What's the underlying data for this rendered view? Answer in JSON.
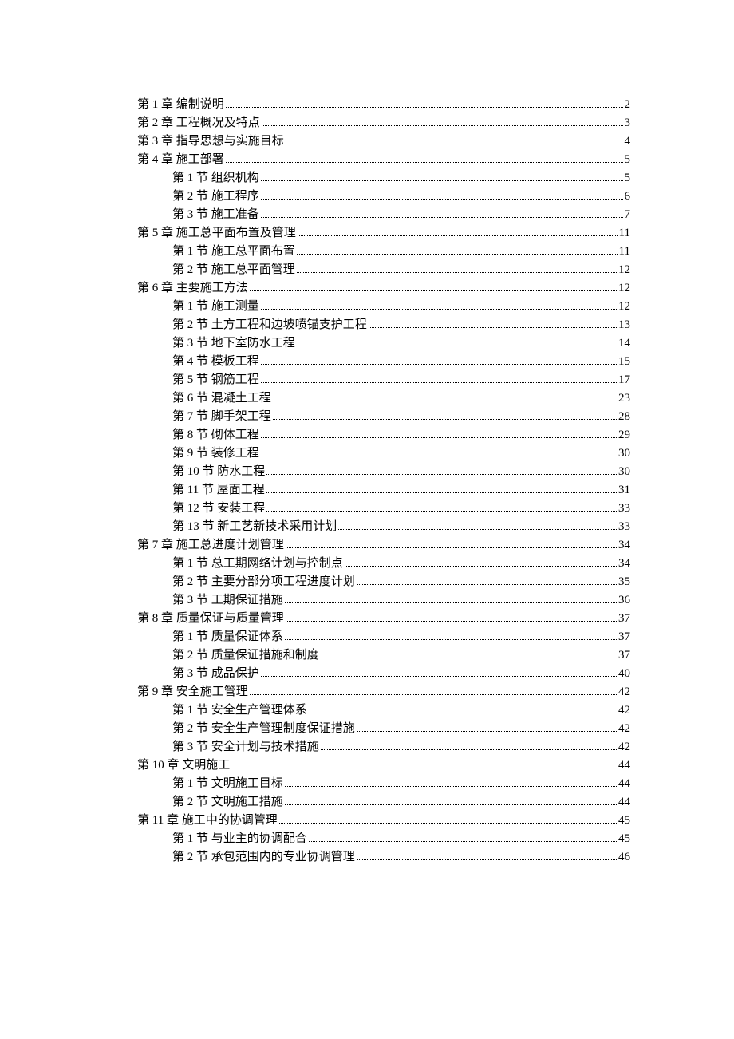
{
  "toc": [
    {
      "level": 1,
      "label": "第 1 章  编制说明",
      "page": "2"
    },
    {
      "level": 1,
      "label": "第 2 章  工程概况及特点",
      "page": "3"
    },
    {
      "level": 1,
      "label": "第 3 章  指导思想与实施目标",
      "page": "4"
    },
    {
      "level": 1,
      "label": "第 4 章  施工部署",
      "page": "5"
    },
    {
      "level": 2,
      "label": "第 1 节  组织机构",
      "page": "5"
    },
    {
      "level": 2,
      "label": "第 2 节  施工程序",
      "page": "6"
    },
    {
      "level": 2,
      "label": "第 3 节  施工准备",
      "page": "7"
    },
    {
      "level": 1,
      "label": "第 5 章  施工总平面布置及管理",
      "page": "11"
    },
    {
      "level": 2,
      "label": "第 1 节  施工总平面布置",
      "page": "11"
    },
    {
      "level": 2,
      "label": "第 2 节  施工总平面管理",
      "page": "12"
    },
    {
      "level": 1,
      "label": "第 6 章  主要施工方法",
      "page": "12"
    },
    {
      "level": 2,
      "label": "第 1 节  施工测量",
      "page": "12"
    },
    {
      "level": 2,
      "label": "第 2 节  土方工程和边坡喷锚支护工程",
      "page": "13"
    },
    {
      "level": 2,
      "label": "第 3 节  地下室防水工程",
      "page": "14"
    },
    {
      "level": 2,
      "label": "第 4 节  模板工程",
      "page": "15"
    },
    {
      "level": 2,
      "label": "第 5 节  钢筋工程",
      "page": "17"
    },
    {
      "level": 2,
      "label": "第 6 节  混凝土工程",
      "page": "23"
    },
    {
      "level": 2,
      "label": "第 7 节  脚手架工程",
      "page": "28"
    },
    {
      "level": 2,
      "label": "第 8 节  砌体工程",
      "page": "29"
    },
    {
      "level": 2,
      "label": "第 9 节  装修工程",
      "page": "30"
    },
    {
      "level": 2,
      "label": "第 10 节  防水工程",
      "page": "30"
    },
    {
      "level": 2,
      "label": "第 11 节  屋面工程",
      "page": "31"
    },
    {
      "level": 2,
      "label": "第 12 节  安装工程",
      "page": "33"
    },
    {
      "level": 2,
      "label": "第 13 节  新工艺新技术采用计划",
      "page": "33"
    },
    {
      "level": 1,
      "label": "第 7 章  施工总进度计划管理",
      "page": "34"
    },
    {
      "level": 2,
      "label": "第 1 节  总工期网络计划与控制点",
      "page": "34"
    },
    {
      "level": 2,
      "label": "第 2 节  主要分部分项工程进度计划",
      "page": "35"
    },
    {
      "level": 2,
      "label": "第 3 节  工期保证措施",
      "page": "36"
    },
    {
      "level": 1,
      "label": "第 8 章  质量保证与质量管理",
      "page": "37"
    },
    {
      "level": 2,
      "label": "第 1 节  质量保证体系",
      "page": "37"
    },
    {
      "level": 2,
      "label": "第 2 节  质量保证措施和制度",
      "page": "37"
    },
    {
      "level": 2,
      "label": "第 3 节  成品保护",
      "page": "40"
    },
    {
      "level": 1,
      "label": "第 9 章  安全施工管理",
      "page": "42"
    },
    {
      "level": 2,
      "label": "第 1 节  安全生产管理体系",
      "page": "42"
    },
    {
      "level": 2,
      "label": "第 2 节  安全生产管理制度保证措施",
      "page": "42"
    },
    {
      "level": 2,
      "label": "第 3 节  安全计划与技术措施",
      "page": "42"
    },
    {
      "level": 1,
      "label": "第 10 章  文明施工",
      "page": "44"
    },
    {
      "level": 2,
      "label": "第 1 节  文明施工目标",
      "page": "44"
    },
    {
      "level": 2,
      "label": "第 2 节  文明施工措施",
      "page": "44"
    },
    {
      "level": 1,
      "label": "第 11 章  施工中的协调管理",
      "page": "45"
    },
    {
      "level": 2,
      "label": "第 1 节  与业主的协调配合",
      "page": "45"
    },
    {
      "level": 2,
      "label": "第 2 节  承包范围内的专业协调管理",
      "page": "46"
    }
  ]
}
